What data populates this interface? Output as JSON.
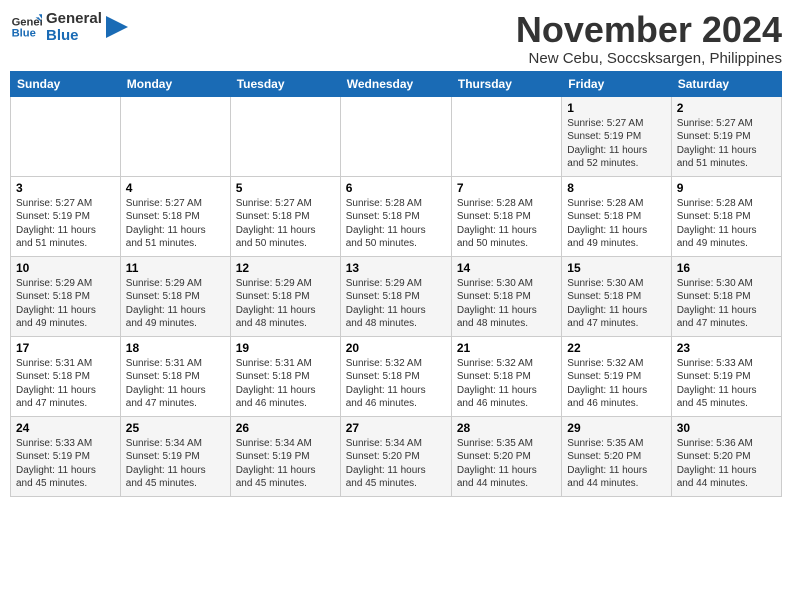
{
  "logo": {
    "line1": "General",
    "line2": "Blue"
  },
  "title": "November 2024",
  "location": "New Cebu, Soccsksargen, Philippines",
  "weekdays": [
    "Sunday",
    "Monday",
    "Tuesday",
    "Wednesday",
    "Thursday",
    "Friday",
    "Saturday"
  ],
  "weeks": [
    [
      {
        "day": "",
        "info": ""
      },
      {
        "day": "",
        "info": ""
      },
      {
        "day": "",
        "info": ""
      },
      {
        "day": "",
        "info": ""
      },
      {
        "day": "",
        "info": ""
      },
      {
        "day": "1",
        "info": "Sunrise: 5:27 AM\nSunset: 5:19 PM\nDaylight: 11 hours\nand 52 minutes."
      },
      {
        "day": "2",
        "info": "Sunrise: 5:27 AM\nSunset: 5:19 PM\nDaylight: 11 hours\nand 51 minutes."
      }
    ],
    [
      {
        "day": "3",
        "info": "Sunrise: 5:27 AM\nSunset: 5:19 PM\nDaylight: 11 hours\nand 51 minutes."
      },
      {
        "day": "4",
        "info": "Sunrise: 5:27 AM\nSunset: 5:18 PM\nDaylight: 11 hours\nand 51 minutes."
      },
      {
        "day": "5",
        "info": "Sunrise: 5:27 AM\nSunset: 5:18 PM\nDaylight: 11 hours\nand 50 minutes."
      },
      {
        "day": "6",
        "info": "Sunrise: 5:28 AM\nSunset: 5:18 PM\nDaylight: 11 hours\nand 50 minutes."
      },
      {
        "day": "7",
        "info": "Sunrise: 5:28 AM\nSunset: 5:18 PM\nDaylight: 11 hours\nand 50 minutes."
      },
      {
        "day": "8",
        "info": "Sunrise: 5:28 AM\nSunset: 5:18 PM\nDaylight: 11 hours\nand 49 minutes."
      },
      {
        "day": "9",
        "info": "Sunrise: 5:28 AM\nSunset: 5:18 PM\nDaylight: 11 hours\nand 49 minutes."
      }
    ],
    [
      {
        "day": "10",
        "info": "Sunrise: 5:29 AM\nSunset: 5:18 PM\nDaylight: 11 hours\nand 49 minutes."
      },
      {
        "day": "11",
        "info": "Sunrise: 5:29 AM\nSunset: 5:18 PM\nDaylight: 11 hours\nand 49 minutes."
      },
      {
        "day": "12",
        "info": "Sunrise: 5:29 AM\nSunset: 5:18 PM\nDaylight: 11 hours\nand 48 minutes."
      },
      {
        "day": "13",
        "info": "Sunrise: 5:29 AM\nSunset: 5:18 PM\nDaylight: 11 hours\nand 48 minutes."
      },
      {
        "day": "14",
        "info": "Sunrise: 5:30 AM\nSunset: 5:18 PM\nDaylight: 11 hours\nand 48 minutes."
      },
      {
        "day": "15",
        "info": "Sunrise: 5:30 AM\nSunset: 5:18 PM\nDaylight: 11 hours\nand 47 minutes."
      },
      {
        "day": "16",
        "info": "Sunrise: 5:30 AM\nSunset: 5:18 PM\nDaylight: 11 hours\nand 47 minutes."
      }
    ],
    [
      {
        "day": "17",
        "info": "Sunrise: 5:31 AM\nSunset: 5:18 PM\nDaylight: 11 hours\nand 47 minutes."
      },
      {
        "day": "18",
        "info": "Sunrise: 5:31 AM\nSunset: 5:18 PM\nDaylight: 11 hours\nand 47 minutes."
      },
      {
        "day": "19",
        "info": "Sunrise: 5:31 AM\nSunset: 5:18 PM\nDaylight: 11 hours\nand 46 minutes."
      },
      {
        "day": "20",
        "info": "Sunrise: 5:32 AM\nSunset: 5:18 PM\nDaylight: 11 hours\nand 46 minutes."
      },
      {
        "day": "21",
        "info": "Sunrise: 5:32 AM\nSunset: 5:18 PM\nDaylight: 11 hours\nand 46 minutes."
      },
      {
        "day": "22",
        "info": "Sunrise: 5:32 AM\nSunset: 5:19 PM\nDaylight: 11 hours\nand 46 minutes."
      },
      {
        "day": "23",
        "info": "Sunrise: 5:33 AM\nSunset: 5:19 PM\nDaylight: 11 hours\nand 45 minutes."
      }
    ],
    [
      {
        "day": "24",
        "info": "Sunrise: 5:33 AM\nSunset: 5:19 PM\nDaylight: 11 hours\nand 45 minutes."
      },
      {
        "day": "25",
        "info": "Sunrise: 5:34 AM\nSunset: 5:19 PM\nDaylight: 11 hours\nand 45 minutes."
      },
      {
        "day": "26",
        "info": "Sunrise: 5:34 AM\nSunset: 5:19 PM\nDaylight: 11 hours\nand 45 minutes."
      },
      {
        "day": "27",
        "info": "Sunrise: 5:34 AM\nSunset: 5:20 PM\nDaylight: 11 hours\nand 45 minutes."
      },
      {
        "day": "28",
        "info": "Sunrise: 5:35 AM\nSunset: 5:20 PM\nDaylight: 11 hours\nand 44 minutes."
      },
      {
        "day": "29",
        "info": "Sunrise: 5:35 AM\nSunset: 5:20 PM\nDaylight: 11 hours\nand 44 minutes."
      },
      {
        "day": "30",
        "info": "Sunrise: 5:36 AM\nSunset: 5:20 PM\nDaylight: 11 hours\nand 44 minutes."
      }
    ]
  ]
}
